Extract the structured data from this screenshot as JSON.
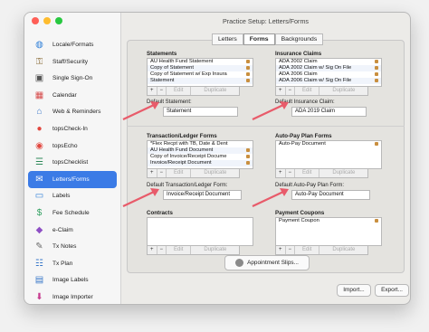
{
  "window": {
    "title": "Practice Setup: Letters/Forms"
  },
  "sidebar": {
    "items": [
      {
        "label": "Locale/Formats",
        "icon": "globe-icon",
        "color": "#2f7fd8",
        "selected": false
      },
      {
        "label": "Staff/Security",
        "icon": "key-icon",
        "color": "#8b6d3a",
        "selected": false
      },
      {
        "label": "Single Sign-On",
        "icon": "lock-icon",
        "color": "#555555",
        "selected": false
      },
      {
        "label": "Calendar",
        "icon": "calendar-icon",
        "color": "#d64c4c",
        "selected": false
      },
      {
        "label": "Web & Reminders",
        "icon": "web-icon",
        "color": "#3a78c9",
        "selected": false
      },
      {
        "label": "topsCheck-In",
        "icon": "location-pin-icon",
        "color": "#e2473f",
        "selected": false
      },
      {
        "label": "topsEcho",
        "icon": "echo-icon",
        "color": "#e2473f",
        "selected": false
      },
      {
        "label": "topsChecklist",
        "icon": "checklist-icon",
        "color": "#2f8a5a",
        "selected": false
      },
      {
        "label": "Letters/Forms",
        "icon": "letters-icon",
        "color": "#ffffff",
        "selected": true
      },
      {
        "label": "Labels",
        "icon": "label-icon",
        "color": "#2f7fd8",
        "selected": false
      },
      {
        "label": "Fee Schedule",
        "icon": "fee-schedule-icon",
        "color": "#2f9f5f",
        "selected": false
      },
      {
        "label": "e-Claim",
        "icon": "eclaim-icon",
        "color": "#8e4fc4",
        "selected": false
      },
      {
        "label": "Tx Notes",
        "icon": "notes-icon",
        "color": "#6b6b6b",
        "selected": false
      },
      {
        "label": "Tx Plan",
        "icon": "tx-plan-icon",
        "color": "#3a78c9",
        "selected": false
      },
      {
        "label": "Image Labels",
        "icon": "image-label-icon",
        "color": "#3a78c9",
        "selected": false
      },
      {
        "label": "Image Importer",
        "icon": "image-importer-icon",
        "color": "#c63b8f",
        "selected": false
      }
    ]
  },
  "tabs": [
    "Letters",
    "Forms",
    "Backgrounds"
  ],
  "sections": {
    "statements": {
      "title": "Statements",
      "items": [
        "AU Health Fund Statement",
        "Copy of Statement",
        "Copy of Statement w/ Exp Insura",
        "Statement"
      ],
      "default_label": "Default Statement:",
      "default_value": "Statement"
    },
    "insurance_claims": {
      "title": "Insurance Claims",
      "items": [
        "ADA 2002 Claim",
        "ADA 2002 Claim w/ Sig On File",
        "ADA 2006 Claim",
        "ADA 2006 Claim w/ Sig On File"
      ],
      "default_label": "Default Insurance Claim:",
      "default_value": "ADA 2019 Claim"
    },
    "transaction_forms": {
      "title": "Transaction/Ledger Forms",
      "items": [
        "*Flex Recpt with TB, Date & Dent",
        "AU Health Fund Document",
        "Copy of Invoice/Receipt Docume",
        "Invoice/Receipt Document"
      ],
      "default_label": "Default Transaction/Ledger Form:",
      "default_value": "Invoice/Receipt Document"
    },
    "autopay_forms": {
      "title": "Auto-Pay Plan Forms",
      "items": [
        "Auto-Pay Document"
      ],
      "default_label": "Default Auto-Pay Plan Form:",
      "default_value": "Auto-Pay Document"
    },
    "contracts": {
      "title": "Contracts",
      "items": []
    },
    "payment_coupons": {
      "title": "Payment Coupons",
      "items": [
        "Payment Coupon"
      ]
    }
  },
  "list_controls": {
    "plus": "+",
    "minus": "−",
    "edit": "Edit",
    "duplicate": "Duplicate"
  },
  "buttons": {
    "appointment_slips": "Appointment Slips...",
    "import": "Import...",
    "export": "Export..."
  },
  "colors": {
    "accent": "#3b7be6",
    "arrow": "#e85b6a",
    "lock": "#c98f3f"
  }
}
